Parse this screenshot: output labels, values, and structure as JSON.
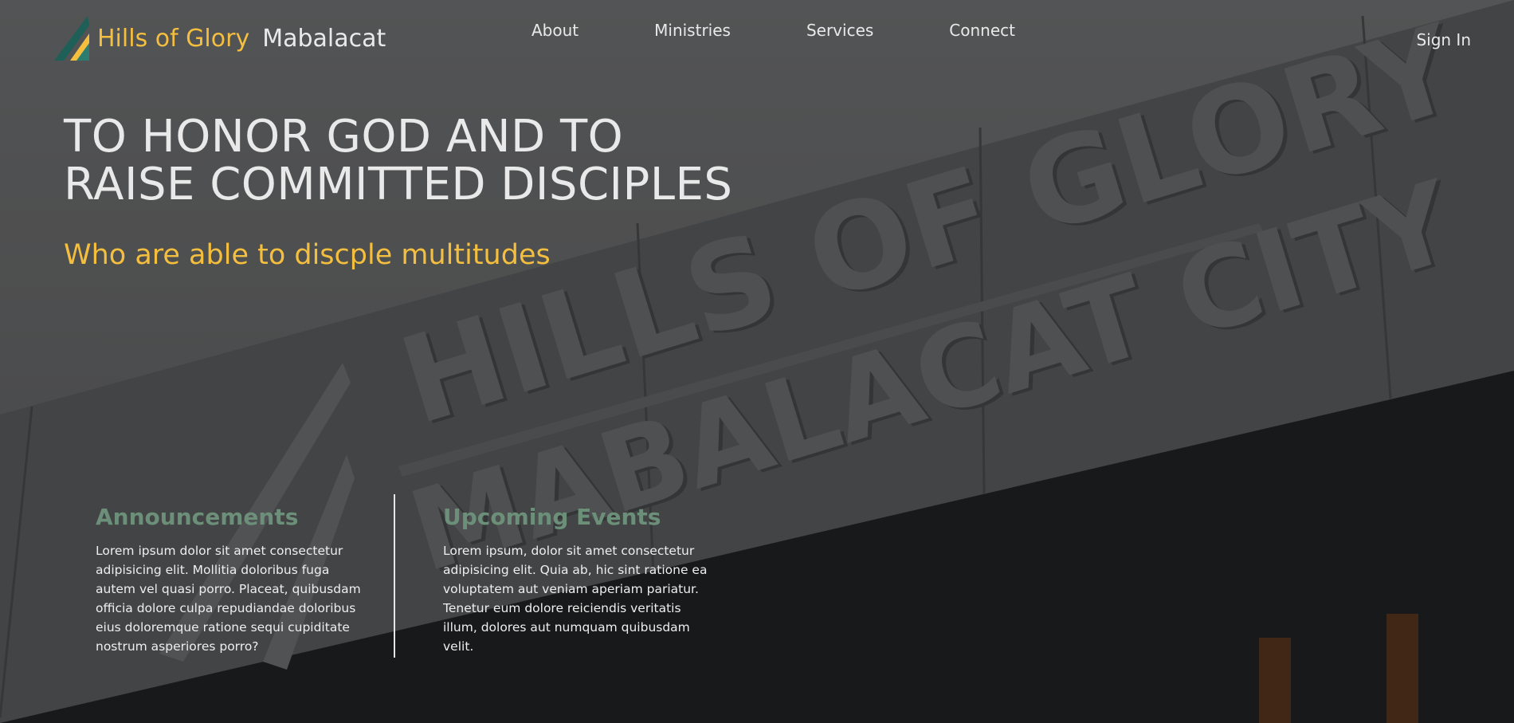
{
  "brand": {
    "name_highlight": "Hills of Glory",
    "name_rest": "Mabalacat",
    "logo_icon": "hills-logo-icon",
    "accent_color": "#f4be3f"
  },
  "nav": {
    "items": [
      {
        "label": "About"
      },
      {
        "label": "Ministries"
      },
      {
        "label": "Services"
      },
      {
        "label": "Connect"
      }
    ],
    "signin_label": "Sign In"
  },
  "hero": {
    "headline_line1": "TO HONOR GOD AND TO",
    "headline_line2": "RAISE COMMITTED DISCIPLES",
    "subheadline": "Who are able to discple multitudes",
    "sign_text_line1": "HILLS OF GLORY",
    "sign_text_line2": "MABALACAT CITY"
  },
  "announcements": {
    "title": "Announcements",
    "body": "Lorem ipsum dolor sit amet consectetur adipisicing elit. Mollitia doloribus fuga autem vel quasi porro. Placeat, quibusdam officia dolore culpa repudiandae doloribus eius doloremque ratione sequi cupiditate nostrum asperiores porro?"
  },
  "events": {
    "title": "Upcoming Events",
    "body": "Lorem ipsum, dolor sit amet consectetur adipisicing elit. Quia ab, hic sint ratione ea voluptatem aut veniam aperiam pariatur. Tenetur eum dolore reiciendis veritatis illum, dolores aut numquam quibusdam velit."
  },
  "colors": {
    "section_title": "#6b8f79",
    "text_light": "#e9e9e9"
  }
}
